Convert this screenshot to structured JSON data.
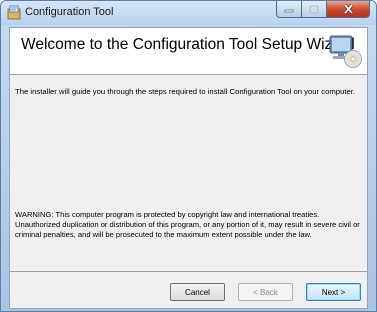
{
  "window": {
    "title": "Configuration Tool",
    "controls": [
      "minimize",
      "maximize",
      "close"
    ]
  },
  "banner": {
    "title": "Welcome to the Configuration Tool Setup Wizard",
    "icon": "computer-cd-icon"
  },
  "body": {
    "intro": "The installer will guide you through the steps required to install Configuration Tool on your computer.",
    "warning": "WARNING: This computer program is protected by copyright law and international treaties. Unauthorized duplication or distribution of this program, or any portion of it, may result in severe civil or criminal penalties, and will be prosecuted to the maximum extent possible under the law."
  },
  "buttons": {
    "cancel": "Cancel",
    "back": "< Back",
    "next": "Next >"
  },
  "colors": {
    "frame": "#b9d1ec",
    "close": "#c9452c",
    "panel": "#f0f0f0"
  }
}
